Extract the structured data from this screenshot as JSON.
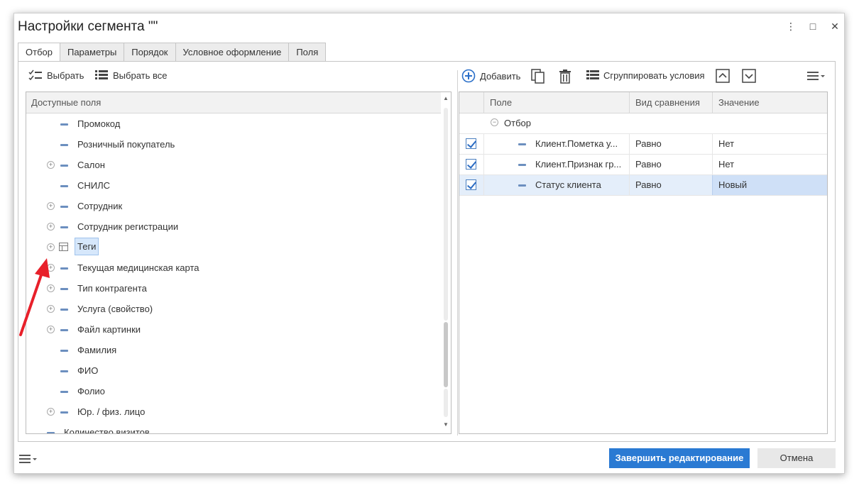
{
  "window": {
    "title": "Настройки сегмента \"\"",
    "more_icon": "⋮",
    "maximize_icon": "□",
    "close_icon": "✕"
  },
  "tabs": [
    {
      "label": "Отбор",
      "active": true
    },
    {
      "label": "Параметры",
      "active": false
    },
    {
      "label": "Порядок",
      "active": false
    },
    {
      "label": "Условное оформление",
      "active": false
    },
    {
      "label": "Поля",
      "active": false
    }
  ],
  "left_toolbar": {
    "select_label": "Выбрать",
    "select_all_label": "Выбрать все"
  },
  "left_panel": {
    "header": "Доступные поля",
    "items": [
      {
        "label": "Промокод",
        "expandable": false,
        "icon": "field"
      },
      {
        "label": "Розничный покупатель",
        "expandable": false,
        "icon": "field"
      },
      {
        "label": "Салон",
        "expandable": true,
        "icon": "field"
      },
      {
        "label": "СНИЛС",
        "expandable": false,
        "icon": "field"
      },
      {
        "label": "Сотрудник",
        "expandable": true,
        "icon": "field"
      },
      {
        "label": "Сотрудник регистрации",
        "expandable": true,
        "icon": "field"
      },
      {
        "label": "Теги",
        "expandable": true,
        "icon": "table",
        "selected": true
      },
      {
        "label": "Текущая медицинская карта",
        "expandable": true,
        "icon": "field"
      },
      {
        "label": "Тип контрагента",
        "expandable": true,
        "icon": "field"
      },
      {
        "label": "Услуга (свойство)",
        "expandable": true,
        "icon": "field"
      },
      {
        "label": "Файл картинки",
        "expandable": true,
        "icon": "field"
      },
      {
        "label": "Фамилия",
        "expandable": false,
        "icon": "field"
      },
      {
        "label": "ФИО",
        "expandable": false,
        "icon": "field"
      },
      {
        "label": "Фолио",
        "expandable": false,
        "icon": "field"
      },
      {
        "label": "Юр. / физ. лицо",
        "expandable": true,
        "icon": "field"
      },
      {
        "label": "Количество визитов",
        "expandable": false,
        "icon": "field"
      }
    ]
  },
  "right_toolbar": {
    "add_label": "Добавить",
    "group_label": "Сгруппировать условия"
  },
  "right_panel": {
    "columns": [
      "Поле",
      "Вид сравнения",
      "Значение"
    ],
    "group_label": "Отбор",
    "rows": [
      {
        "checked": true,
        "field": "Клиент.Пометка у...",
        "comparison": "Равно",
        "value": "Нет"
      },
      {
        "checked": true,
        "field": "Клиент.Признак гр...",
        "comparison": "Равно",
        "value": "Нет"
      },
      {
        "checked": true,
        "field": "Статус клиента",
        "comparison": "Равно",
        "value": "Новый"
      }
    ]
  },
  "footer": {
    "finish_label": "Завершить редактирование",
    "cancel_label": "Отмена"
  },
  "colors": {
    "primary_button": "#2a7ad3",
    "annotation_arrow": "#e8202a",
    "selection": "#d6e7fb"
  }
}
